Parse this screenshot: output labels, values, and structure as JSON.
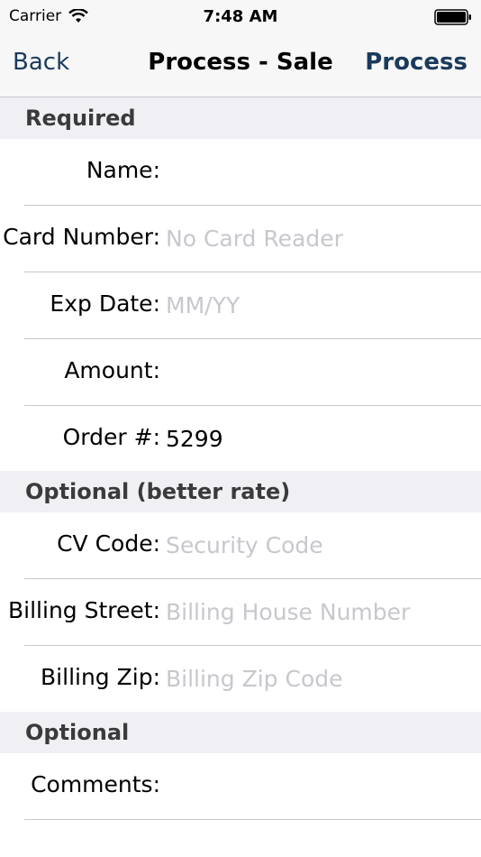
{
  "status_bar": {
    "carrier": "Carrier",
    "time": "7:48 AM"
  },
  "nav": {
    "back_label": "Back",
    "title": "Process - Sale",
    "process_label": "Process"
  },
  "sections": {
    "required": "Required",
    "optional_better": "Optional (better rate)",
    "optional": "Optional"
  },
  "fields": {
    "name": {
      "label": "Name:",
      "value": "",
      "placeholder": ""
    },
    "card_number": {
      "label": "Card Number:",
      "value": "",
      "placeholder": "No Card Reader"
    },
    "exp_date": {
      "label": "Exp Date:",
      "value": "",
      "placeholder": "MM/YY"
    },
    "amount": {
      "label": "Amount:",
      "value": "",
      "placeholder": ""
    },
    "order": {
      "label": "Order #:",
      "value": "5299",
      "placeholder": ""
    },
    "cv_code": {
      "label": "CV Code:",
      "value": "",
      "placeholder": "Security Code"
    },
    "billing_street": {
      "label": "Billing Street:",
      "value": "",
      "placeholder": "Billing House Number"
    },
    "billing_zip": {
      "label": "Billing Zip:",
      "value": "",
      "placeholder": "Billing Zip Code"
    },
    "comments": {
      "label": "Comments:",
      "value": "",
      "placeholder": ""
    }
  },
  "colors": {
    "accent": "#1a3a5c",
    "section_bg": "#efeff4",
    "placeholder": "#c7c7cd",
    "separator": "#c8c7cc"
  }
}
